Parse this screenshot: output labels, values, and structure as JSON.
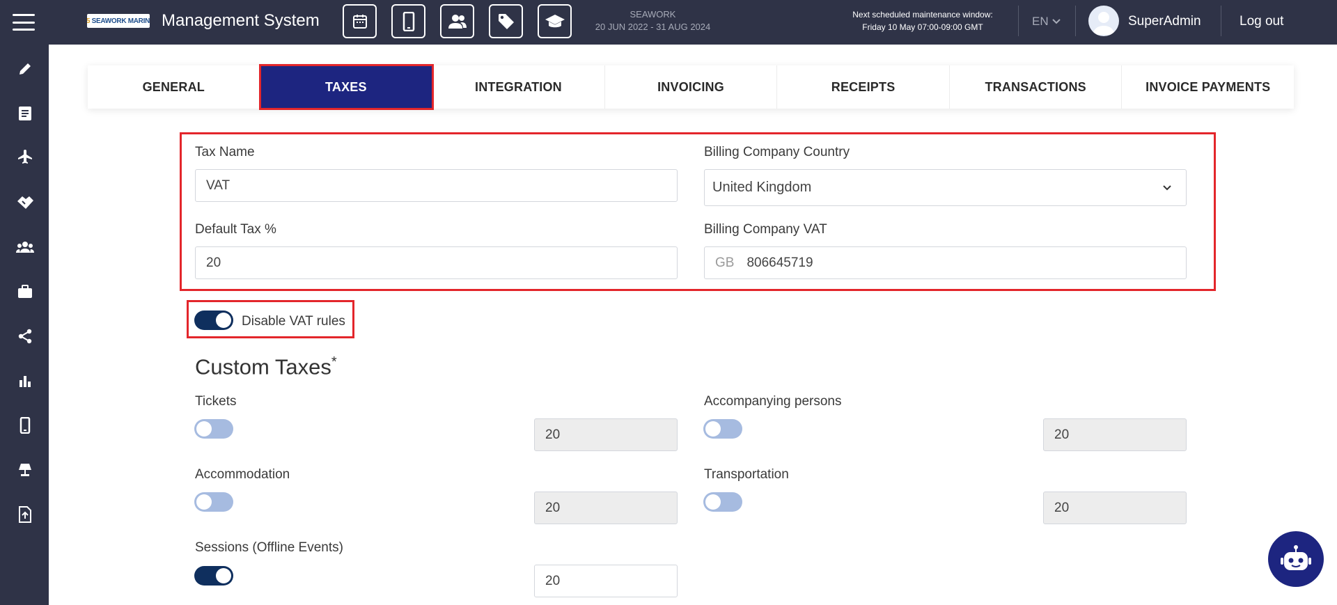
{
  "header": {
    "app_title": "Management System",
    "logo_text": "25 SEAWORK MARINE",
    "quick_icons": [
      "calendar-icon",
      "mobile-icon",
      "people-icon",
      "tag-icon",
      "graduation-cap-icon"
    ],
    "event": {
      "name": "SEAWORK",
      "dates": "20 JUN 2022 - 31 AUG 2024"
    },
    "maintenance": {
      "line1": "Next scheduled maintenance window:",
      "line2": "Friday 10 May 07:00-09:00 GMT"
    },
    "language": "EN",
    "user": "SuperAdmin",
    "logout_label": "Log out"
  },
  "sidebar": {
    "items": [
      "pencil-icon",
      "list-icon",
      "plane-icon",
      "handshake-icon",
      "group-icon",
      "briefcase-icon",
      "share-icon",
      "bar-chart-icon",
      "mobile-icon",
      "lamp-icon",
      "upload-file-icon"
    ]
  },
  "tabs": [
    {
      "label": "GENERAL",
      "active": false
    },
    {
      "label": "TAXES",
      "active": true
    },
    {
      "label": "INTEGRATION",
      "active": false
    },
    {
      "label": "INVOICING",
      "active": false
    },
    {
      "label": "RECEIPTS",
      "active": false
    },
    {
      "label": "TRANSACTIONS",
      "active": false
    },
    {
      "label": "INVOICE PAYMENTS",
      "active": false
    }
  ],
  "form": {
    "tax_name_label": "Tax Name",
    "tax_name_value": "VAT",
    "billing_country_label": "Billing Company Country",
    "billing_country_value": "United Kingdom",
    "default_tax_label": "Default Tax %",
    "default_tax_value": "20",
    "billing_vat_label": "Billing Company VAT",
    "billing_vat_prefix": "GB",
    "billing_vat_value": "806645719",
    "disable_vat_label": "Disable VAT rules",
    "disable_vat_on": true
  },
  "custom_taxes": {
    "title": "Custom Taxes",
    "required_mark": "*",
    "items": [
      {
        "label": "Tickets",
        "enabled": false,
        "value": "20"
      },
      {
        "label": "Accompanying persons",
        "enabled": false,
        "value": "20"
      },
      {
        "label": "Accommodation",
        "enabled": false,
        "value": "20"
      },
      {
        "label": "Transportation",
        "enabled": false,
        "value": "20"
      },
      {
        "label": "Sessions (Offline Events)",
        "enabled": true,
        "value": "20"
      }
    ]
  },
  "colors": {
    "dark_bar": "#2f3347",
    "active_tab": "#1d2580",
    "highlight_red": "#e3262b",
    "toggle_on": "#0f2f5e",
    "toggle_off": "#a6bbe0"
  }
}
